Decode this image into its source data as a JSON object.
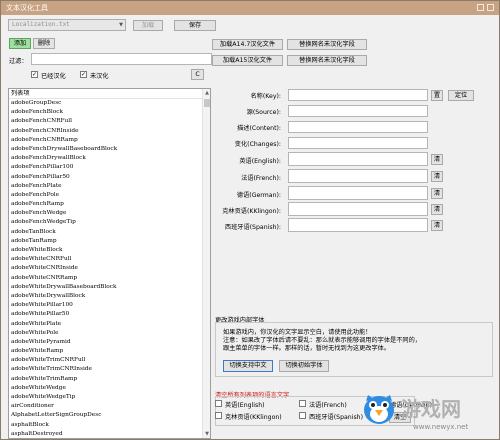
{
  "window": {
    "title": "文本汉化工具"
  },
  "toolbar": {
    "file_combo": "Localization.txt",
    "load_label": "加载",
    "save_label": "保存",
    "add_label": "添加",
    "delete_label": "删除"
  },
  "filter": {
    "label": "过滤：",
    "value": "",
    "translated_label": "已经汉化",
    "translated_checked": true,
    "untranslated_label": "未汉化",
    "untranslated_checked": true,
    "c_button": "C"
  },
  "actions": {
    "load_a14": "加载A14.7汉化文件",
    "load_a15": "加载A15汉化文件",
    "replace_1": "替换网名未汉化字段",
    "replace_2": "替换网名未汉化字段"
  },
  "list": {
    "header": "列表项",
    "items": [
      "adobeGroupDesc",
      "adobeFenchBlock",
      "adobeFenchCNRFull",
      "adobeFenchCNRInside",
      "adobeFenchCNRRamp",
      "adobeFenchDrywallBaseboardBlock",
      "adobeFenchDrywallBlock",
      "adobeFenchPillar100",
      "adobeFenchPillar50",
      "adobeFenchPlate",
      "adobeFenchPole",
      "adobeFenchRamp",
      "adobeFenchWedge",
      "adobeFenchWedgeTip",
      "adobeTanBlock",
      "adobeTanRamp",
      "adobeWhiteBlock",
      "adobeWhiteCNRFull",
      "adobeWhiteCNRInside",
      "adobeWhiteCNRRamp",
      "adobeWhiteDrywallBaseboardBlock",
      "adobeWhiteDrywallBlock",
      "adobeWhitePillar100",
      "adobeWhitePillar50",
      "adobeWhitePlate",
      "adobeWhitePole",
      "adobeWhitePyramid",
      "adobeWhiteRamp",
      "adobeWhiteTrimCNRFull",
      "adobeWhiteTrimCNRInside",
      "adobeWhiteTrimRamp",
      "adobeWhiteWedge",
      "adobeWhiteWedgeTip",
      "airConditioner",
      "AlphabetLetterSignGroupDesc",
      "asphaltBlock",
      "asphaltDestroyed"
    ]
  },
  "detail": {
    "key_label": "名称(Key):",
    "key_value": "",
    "key_btn1": "置",
    "key_btn2": "定位",
    "source_label": "源(Source):",
    "context_label": "描述(Content):",
    "changes_label": "变化(Changes):",
    "english_label": "英语(English):",
    "french_label": "法语(French):",
    "german_label": "德语(German):",
    "klingon_label": "克林贡语(KKlingon):",
    "spanish_label": "西班牙语(Spanish):",
    "clear_btn": "清"
  },
  "font_section": {
    "title": "更改游戏内部字体",
    "line1": "如果游戏内，你汉化的文字显示空白，请使用此功能！",
    "line2": "注意：如果改了字体后请不要乱：那么就表示能够调用的字体是不同的，",
    "line3": "跟主菜单的字体一样。那样的话，暂时无找到为这更改字体。",
    "btn_cn": "切换支持中文",
    "btn_orig": "切换初始字体"
  },
  "clear_section": {
    "title": "清空所有列表项的语言文字",
    "english": "英语(English)",
    "french": "法语(French)",
    "german": "德语(German)",
    "klingon": "克林贡语(KKlingon)",
    "spanish": "西班牙语(Spanish)",
    "clear_btn": "清空"
  },
  "watermark": {
    "text": "游戏网",
    "url": "www.newyx.net"
  },
  "colors": {
    "titlebar": "#c8a383",
    "accent_red": "#d01616",
    "add_button": "#9fe09f"
  }
}
